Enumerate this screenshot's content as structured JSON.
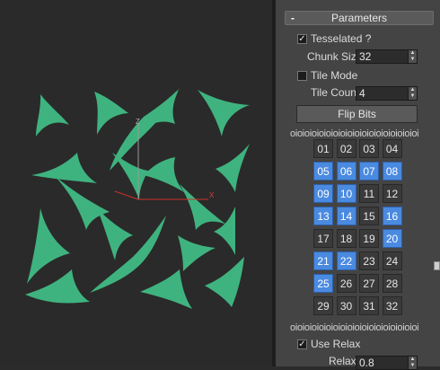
{
  "viewport": {
    "axis_labels": {
      "x": "X",
      "y": "Y",
      "z": "Z"
    },
    "colors": {
      "shape": "#3fb37f",
      "x_axis": "#d0302a",
      "y_axis": "#5d8c3c",
      "z_axis": "#9a9a9a"
    }
  },
  "panel": {
    "rollout": {
      "toggle": "-",
      "title": "Parameters"
    },
    "tesselated": {
      "label": "Tesselated ?",
      "checked": true,
      "mark": "✓"
    },
    "chunk_size": {
      "label": "Chunk Size",
      "value": "32"
    },
    "tile_mode": {
      "label": "Tile Mode",
      "checked": false,
      "mark": ""
    },
    "tile_count": {
      "label": "Tile Count",
      "value": "4"
    },
    "flip_bits_label": "Flip Bits",
    "divider_top": "oioioioioioioioioioioioioioioioioioi",
    "divider_bottom": "oioioioioioioioioioioioioioioioioioi",
    "bits": [
      {
        "label": "01",
        "on": false
      },
      {
        "label": "02",
        "on": false
      },
      {
        "label": "03",
        "on": false
      },
      {
        "label": "04",
        "on": false
      },
      {
        "label": "05",
        "on": true
      },
      {
        "label": "06",
        "on": true
      },
      {
        "label": "07",
        "on": true
      },
      {
        "label": "08",
        "on": true
      },
      {
        "label": "09",
        "on": true
      },
      {
        "label": "10",
        "on": true
      },
      {
        "label": "11",
        "on": false
      },
      {
        "label": "12",
        "on": false
      },
      {
        "label": "13",
        "on": true
      },
      {
        "label": "14",
        "on": true
      },
      {
        "label": "15",
        "on": false
      },
      {
        "label": "16",
        "on": true
      },
      {
        "label": "17",
        "on": false
      },
      {
        "label": "18",
        "on": false
      },
      {
        "label": "19",
        "on": false
      },
      {
        "label": "20",
        "on": true
      },
      {
        "label": "21",
        "on": true
      },
      {
        "label": "22",
        "on": true
      },
      {
        "label": "23",
        "on": false
      },
      {
        "label": "24",
        "on": false
      },
      {
        "label": "25",
        "on": true
      },
      {
        "label": "26",
        "on": false
      },
      {
        "label": "27",
        "on": false
      },
      {
        "label": "28",
        "on": false
      },
      {
        "label": "29",
        "on": false
      },
      {
        "label": "30",
        "on": false
      },
      {
        "label": "31",
        "on": false
      },
      {
        "label": "32",
        "on": false
      }
    ],
    "use_relax": {
      "label": "Use Relax",
      "checked": true,
      "mark": "✓"
    },
    "relax": {
      "label": "Relax",
      "value": "0.8"
    },
    "spinner_arrows": "▲\n▼",
    "accent_color": "#4a8ae0"
  }
}
